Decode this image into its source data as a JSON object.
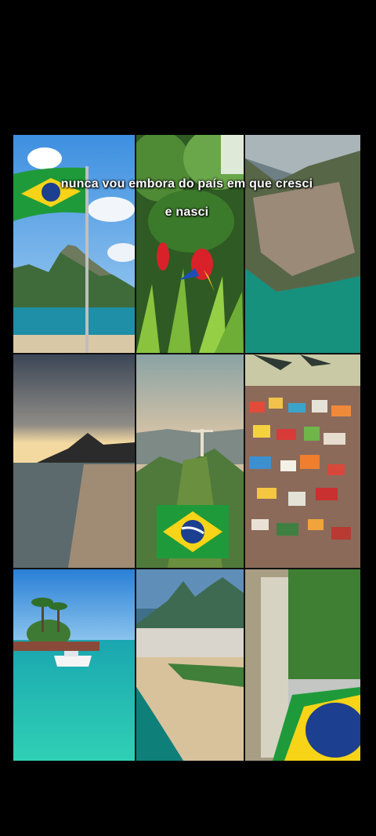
{
  "caption": {
    "line1": "nunca vou embora do país em que cresci",
    "line2": "e nasci"
  },
  "colors": {
    "background": "#000000",
    "brazil_green": "#1f9a3a",
    "brazil_yellow": "#f7d417",
    "brazil_blue": "#1d3f8f"
  },
  "tiles": [
    {
      "scene": "flag-over-sugarloaf"
    },
    {
      "scene": "scarlet-macaws-in-jungle"
    },
    {
      "scene": "aerial-favela-coast"
    },
    {
      "scene": "beach-sunset-silhouette"
    },
    {
      "scene": "christ-the-redeemer"
    },
    {
      "scene": "colorful-favela-houses"
    },
    {
      "scene": "tropical-island-boat"
    },
    {
      "scene": "copacabana-aerial"
    },
    {
      "scene": "flag-painted-stairs"
    }
  ]
}
